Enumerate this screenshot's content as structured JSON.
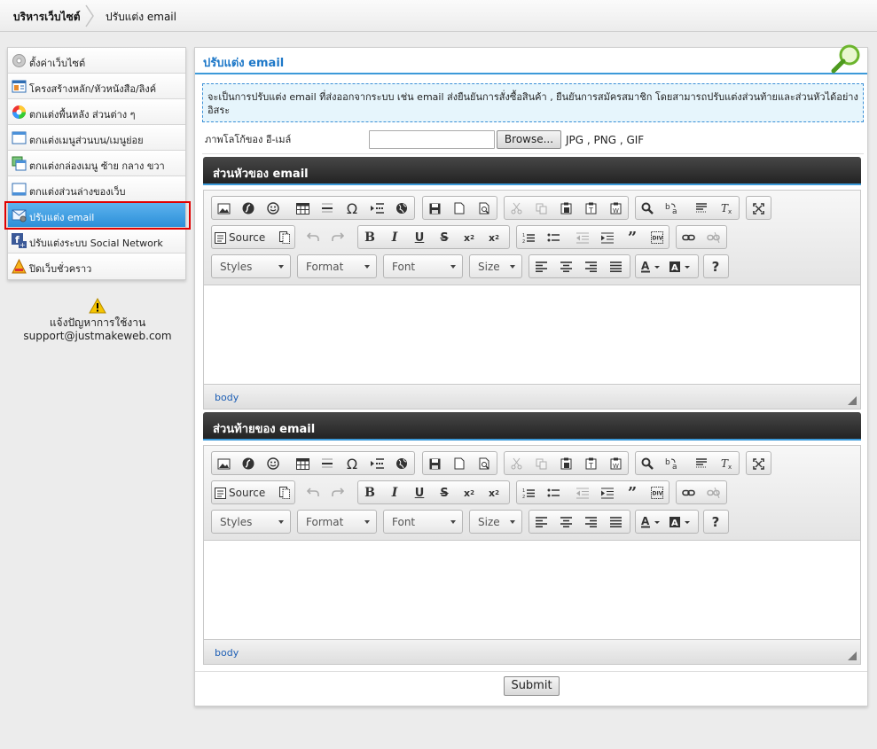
{
  "breadcrumb": {
    "first": "บริหารเว็บไซต์",
    "second": "ปรับแต่ง email"
  },
  "sidebar": {
    "items": [
      {
        "label": "ตั้งค่าเว็บไซต์",
        "icon": "gear-icon"
      },
      {
        "label": "โครงสร้างหลัก/หัวหนังสือ/ลิงค์",
        "icon": "structure-icon"
      },
      {
        "label": "ตกแต่งพื้นหลัง ส่วนต่าง ๆ",
        "icon": "color-wheel-icon"
      },
      {
        "label": "ตกแต่งเมนูส่วนบน/เมนูย่อย",
        "icon": "menu-window-icon"
      },
      {
        "label": "ตกแต่งกล่องเมนู ซ้าย กลาง ขวา",
        "icon": "menu-box-icon"
      },
      {
        "label": "ตกแต่งส่วนล่างของเว็บ",
        "icon": "footer-window-icon"
      },
      {
        "label": "ปรับแต่ง email",
        "icon": "email-icon"
      },
      {
        "label": "ปรับแต่งระบบ Social Network",
        "icon": "facebook-icon"
      },
      {
        "label": "ปิดเว็บชั่วคราว",
        "icon": "under-construction-icon"
      }
    ],
    "active_index": 6
  },
  "support": {
    "line1": "แจ้งปัญหาการใช้งาน",
    "email": "support@justmakeweb.com"
  },
  "main": {
    "title": "ปรับแต่ง email",
    "info": "จะเป็นการปรับแต่ง email ที่ส่งออกจากระบบ เช่น email ส่งยืนยันการสั่งซื้อสินค้า , ยืนยันการสมัครสมาชิก โดยสามารถปรับแต่งส่วนท้ายและส่วนหัวได้อย่าง อิสระ",
    "logo_label": "ภาพโลโก้ของ อี-เมล์",
    "browse_label": "Browse...",
    "file_hint": "JPG , PNG , GIF",
    "header_section": "ส่วนหัวของ email",
    "footer_section": "ส่วนท้ายของ email",
    "submit_label": "Submit"
  },
  "editor": {
    "source_label": "Source",
    "styles": "Styles",
    "format": "Format",
    "font": "Font",
    "size": "Size",
    "path": "body"
  }
}
